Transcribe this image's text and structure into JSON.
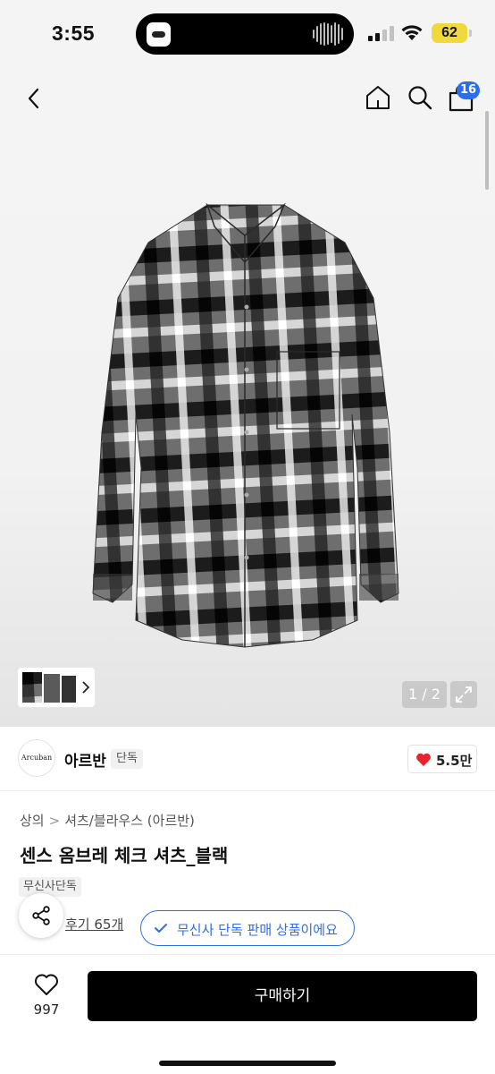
{
  "status_bar": {
    "time": "3:55",
    "battery": "62"
  },
  "header": {
    "cart_count": "16"
  },
  "gallery": {
    "pager": "1 / 2"
  },
  "brand": {
    "logo_text": "Arcuban",
    "name": "아르반",
    "tag": "단독",
    "likes": "5.5만"
  },
  "product": {
    "breadcrumb": [
      "상의",
      "셔츠/블라우스 (아르반)"
    ],
    "title": "센스 옴브레 체크 셔츠_블랙",
    "exclusive_tag": "무신사단독",
    "reviews": "후기 65개",
    "exclusive_badge": "무신사 단독 판매 상품이에요"
  },
  "bottom_bar": {
    "wish_count": "997",
    "buy_label": "구매하기"
  },
  "colors": {
    "accent": "#2f6fe6",
    "heart": "#e8232c",
    "buy_button": "#000000",
    "battery": "#f2d93b"
  },
  "icons": [
    "back-icon",
    "home-icon",
    "search-icon",
    "shopping-bag-icon",
    "chevron-right-icon",
    "expand-icon",
    "heart-filled-icon",
    "share-icon",
    "check-icon",
    "heart-outline-icon"
  ]
}
